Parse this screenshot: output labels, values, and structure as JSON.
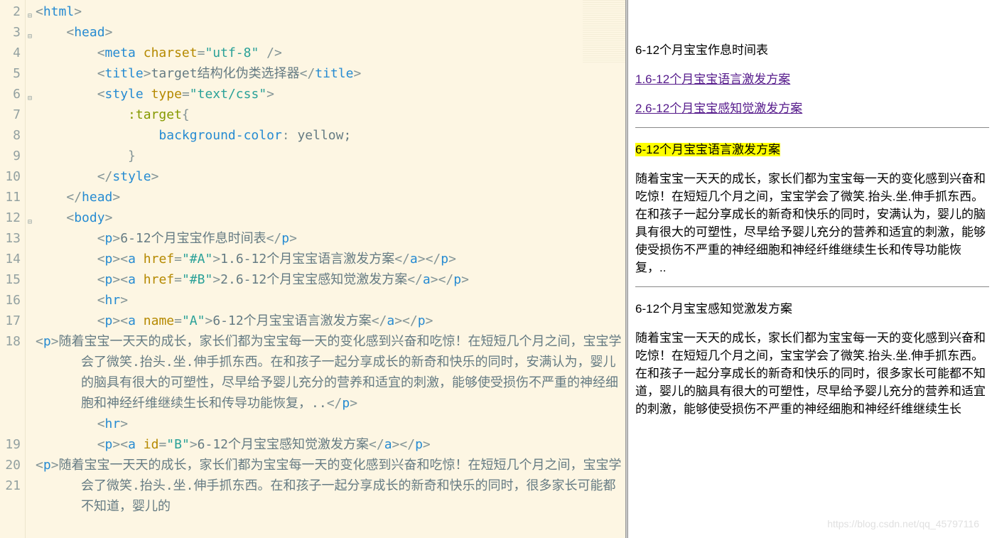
{
  "gutter": [
    "2",
    "3",
    "4",
    "5",
    "6",
    "7",
    "8",
    "9",
    "10",
    "11",
    "12",
    "13",
    "14",
    "15",
    "16",
    "17",
    "18",
    "19",
    "20",
    "21"
  ],
  "fold_lines": [
    "2",
    "3",
    "6",
    "12"
  ],
  "code": {
    "l2": {
      "tag": "html"
    },
    "l3": {
      "tag": "head"
    },
    "l4": {
      "tag": "meta",
      "attr": "charset",
      "val": "\"utf-8\"",
      "selfclose": " />"
    },
    "l5": {
      "open": "title",
      "text": "target结构化伪类选择器",
      "close": "title"
    },
    "l6": {
      "tag": "style",
      "attr": "type",
      "val": "\"text/css\""
    },
    "l7": {
      "sel": ":target",
      "brace": "{"
    },
    "l8": {
      "prop": "background-color",
      "pv": " yellow;"
    },
    "l9": {
      "brace": "}"
    },
    "l10": {
      "close": "style"
    },
    "l11": {
      "close": "head"
    },
    "l12": {
      "tag": "body"
    },
    "l13": {
      "open": "p",
      "text": "6-12个月宝宝作息时间表",
      "close": "p"
    },
    "l14": {
      "outer": "p",
      "inner": "a",
      "attr": "href",
      "val": "\"#A\"",
      "text": "1.6-12个月宝宝语言激发方案"
    },
    "l15": {
      "outer": "p",
      "inner": "a",
      "attr": "href",
      "val": "\"#B\"",
      "text": "2.6-12个月宝宝感知觉激发方案"
    },
    "l16": {
      "tag": "hr"
    },
    "l17": {
      "outer": "p",
      "inner": "a",
      "attr": "name",
      "val": "\"A\"",
      "text": "6-12个月宝宝语言激发方案"
    },
    "l18": {
      "open": "p",
      "text": "随着宝宝一天天的成长，家长们都为宝宝每一天的变化感到兴奋和吃惊！在短短几个月之间，宝宝学会了微笑.抬头.坐.伸手抓东西。在和孩子一起分享成长的新奇和快乐的同时，安满认为，婴儿的脑具有很大的可塑性，尽早给予婴儿充分的营养和适宜的刺激，能够使受损伤不严重的神经细胞和神经纤维继续生长和传导功能恢复，..",
      "close": "p"
    },
    "l19": {
      "tag": "hr"
    },
    "l20": {
      "outer": "p",
      "inner": "a",
      "attr": "id",
      "val": "\"B\"",
      "text": "6-12个月宝宝感知觉激发方案"
    },
    "l21": {
      "open": "p",
      "text": "随着宝宝一天天的成长，家长们都为宝宝每一天的变化感到兴奋和吃惊！在短短几个月之间，宝宝学会了微笑.抬头.坐.伸手抓东西。在和孩子一起分享成长的新奇和快乐的同时，很多家长可能都不知道，婴儿的"
    }
  },
  "preview": {
    "p1": "6-12个月宝宝作息时间表",
    "link1": "1.6-12个月宝宝语言激发方案",
    "link2": "2.6-12个月宝宝感知觉激发方案",
    "anchorA": "6-12个月宝宝语言激发方案",
    "paraA": "随着宝宝一天天的成长，家长们都为宝宝每一天的变化感到兴奋和吃惊！在短短几个月之间，宝宝学会了微笑.抬头.坐.伸手抓东西。在和孩子一起分享成长的新奇和快乐的同时，安满认为，婴儿的脑具有很大的可塑性，尽早给予婴儿充分的营养和适宜的刺激，能够使受损伤不严重的神经细胞和神经纤维继续生长和传导功能恢复，..",
    "anchorB": "6-12个月宝宝感知觉激发方案",
    "paraB": "随着宝宝一天天的成长，家长们都为宝宝每一天的变化感到兴奋和吃惊！在短短几个月之间，宝宝学会了微笑.抬头.坐.伸手抓东西。在和孩子一起分享成长的新奇和快乐的同时，很多家长可能都不知道，婴儿的脑具有很大的可塑性，尽早给予婴儿充分的营养和适宜的刺激，能够使受损伤不严重的神经细胞和神经纤维继续生长"
  },
  "watermark": "https://blog.csdn.net/qq_45797116"
}
